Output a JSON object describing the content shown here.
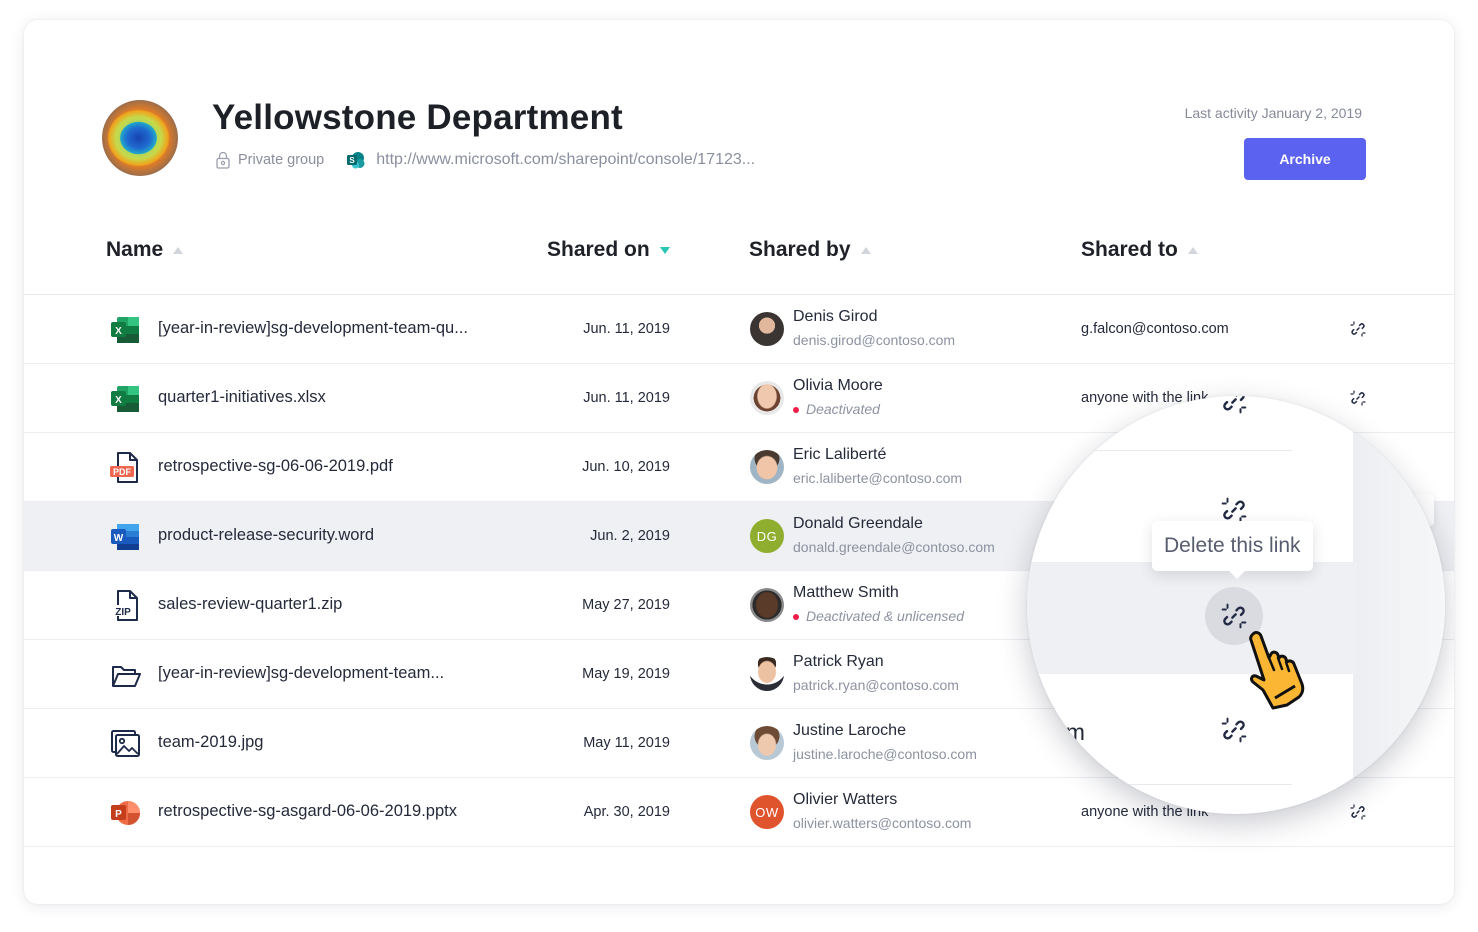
{
  "group": {
    "title": "Yellowstone Department",
    "privacy": "Private group",
    "url": "http://www.microsoft.com/sharepoint/console/17123...",
    "last_activity": "Last activity January 2, 2019",
    "archive_label": "Archive",
    "avatar_icon": "yellowstone-photo"
  },
  "colors": {
    "accent": "#5b62f0",
    "sort_active": "#26c6b2",
    "status_red": "#ec1d48",
    "row_highlight": "#eff0f3",
    "cursor_hand": "#fbb634"
  },
  "table": {
    "columns": [
      {
        "label": "Name",
        "sort": "inactive-asc"
      },
      {
        "label": "Shared on",
        "sort": "active-desc"
      },
      {
        "label": "Shared by",
        "sort": "inactive-asc"
      },
      {
        "label": "Shared to",
        "sort": "inactive-asc"
      }
    ],
    "rows": [
      {
        "icon": "excel-icon",
        "name": "[year-in-review]sg-development-team-qu...",
        "date": "Jun. 11, 2019",
        "person": "Denis Girod",
        "sub": "denis.girod@contoso.com",
        "status": false,
        "shared_to": "g.falcon@contoso.com",
        "action_icon": "unlink-icon"
      },
      {
        "icon": "excel-icon",
        "name": "quarter1-initiatives.xlsx",
        "date": "Jun. 11, 2019",
        "person": "Olivia Moore",
        "sub": "Deactivated",
        "status": true,
        "shared_to": "anyone with the link",
        "action_icon": "unlink-icon"
      },
      {
        "icon": "pdf-icon",
        "name": "retrospective-sg-06-06-2019.pdf",
        "date": "Jun. 10, 2019",
        "person": "Eric Laliberté",
        "sub": "eric.laliberte@contoso.com",
        "status": false,
        "shared_to": "",
        "action_icon": "unlink-icon"
      },
      {
        "icon": "word-icon",
        "name": "product-release-security.word",
        "date": "Jun. 2, 2019",
        "person": "Donald Greendale",
        "initials": "DG",
        "sub": "donald.greendale@contoso.com",
        "status": false,
        "shared_to": "",
        "action_icon": "unlink-icon",
        "highlighted": true
      },
      {
        "icon": "zip-icon",
        "name": "sales-review-quarter1.zip",
        "date": "May 27, 2019",
        "person": "Matthew Smith",
        "sub": "Deactivated & unlicensed",
        "status": true,
        "shared_to": "",
        "action_icon": "unlink-icon"
      },
      {
        "icon": "folder-icon",
        "name": "[year-in-review]sg-development-team...",
        "date": "May 19, 2019",
        "person": "Patrick Ryan",
        "sub": "patrick.ryan@contoso.com",
        "status": false,
        "shared_to": "",
        "action_icon": "unlink-icon"
      },
      {
        "icon": "image-icon",
        "name": "team-2019.jpg",
        "date": "May 11, 2019",
        "person": "Justine Laroche",
        "sub": "justine.laroche@contoso.com",
        "status": false,
        "shared_to": "",
        "action_icon": "unlink-icon"
      },
      {
        "icon": "powerpoint-icon",
        "name": "retrospective-sg-asgard-06-06-2019.pptx",
        "date": "Apr. 30, 2019",
        "person": "Olivier Watters",
        "initials": "OW",
        "sub": "olivier.watters@contoso.com",
        "status": false,
        "shared_to": "anyone with the link",
        "action_icon": "unlink-icon"
      }
    ]
  },
  "magnifier": {
    "tooltip": "Delete this link",
    "partial_text": "om"
  }
}
